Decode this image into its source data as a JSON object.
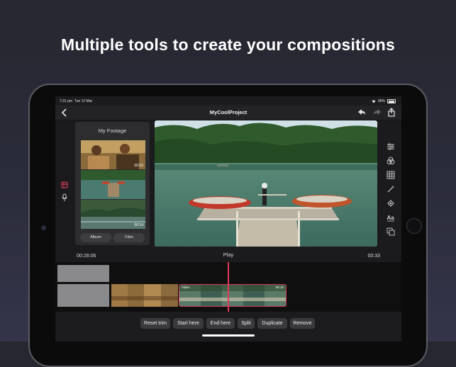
{
  "headline": "Multiple tools to create your compositions",
  "status_bar": {
    "time": "7:31 pm",
    "date": "Tue 12 Mar",
    "battery_percent": "96%",
    "battery_level": 0.96
  },
  "nav": {
    "title": "MyCoolProject",
    "back_icon": "chevron-left-icon",
    "undo_icon": "undo-icon",
    "redo_icon": "redo-icon",
    "share_icon": "share-icon"
  },
  "footage": {
    "title": "My Footage",
    "thumbnails": [
      {
        "duration": "00:10"
      },
      {
        "duration": ""
      },
      {
        "duration": "00:14"
      }
    ],
    "album_label": "Album",
    "files_label": "Files"
  },
  "left_tools": [
    "media-icon",
    "microphone-icon"
  ],
  "right_tools": [
    "adjustments-icon",
    "filters-icon",
    "grid-icon",
    "magic-wand-icon",
    "stickers-icon",
    "text-icon",
    "layers-icon"
  ],
  "playback": {
    "current_time": "00:28:06",
    "play_label": "Play",
    "clip_duration": "00:33"
  },
  "timeline": {
    "clip_label": "Video",
    "clip_duration": "00:10"
  },
  "actions": {
    "reset_trim": "Reset trim",
    "start_here": "Start here",
    "end_here": "End here",
    "split": "Split",
    "duplicate": "Duplicate",
    "remove": "Remove"
  },
  "colors": {
    "accent": "#e23a5a",
    "selection": "#d8385a"
  }
}
